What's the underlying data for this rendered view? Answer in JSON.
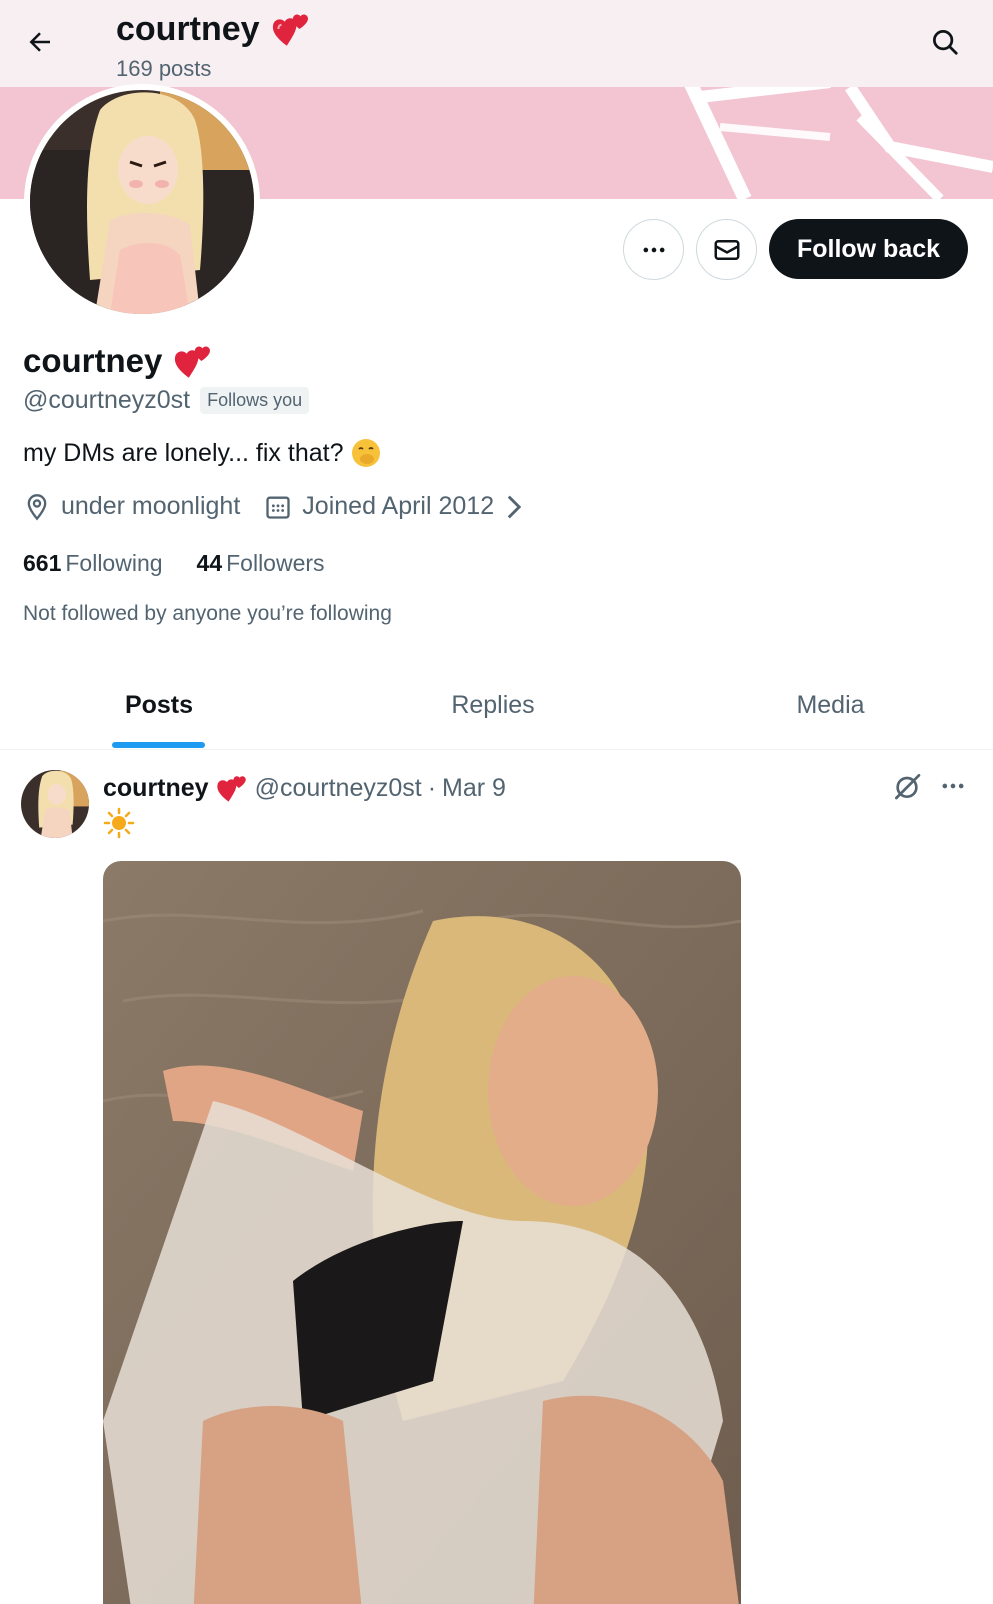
{
  "header": {
    "title": "courtney",
    "title_emoji": "heart-emoji",
    "posts_count": "169 posts",
    "back_icon": "arrow-left-icon",
    "search_icon": "search-icon"
  },
  "profile": {
    "name": "courtney",
    "handle": "@courtneyz0st",
    "follows_you": "Follows you",
    "bio": "my DMs are lonely... fix that?",
    "location": "under moonlight",
    "joined": "Joined April 2012",
    "following_count": "661",
    "following_label": "Following",
    "followers_count": "44",
    "followers_label": "Followers",
    "not_followed": "Not followed by anyone you’re following"
  },
  "actions": {
    "follow_back": "Follow back"
  },
  "tabs": [
    {
      "label": "Posts",
      "active": true
    },
    {
      "label": "Replies",
      "active": false
    },
    {
      "label": "Media",
      "active": false
    }
  ],
  "post": {
    "name": "courtney",
    "handle": "@courtneyz0st",
    "separator": "·",
    "date": "Mar 9",
    "text_emoji": "sun-emoji"
  },
  "colors": {
    "banner": "#f3c4d2",
    "accent": "#1d9bf0",
    "follow_button": "#0f1419",
    "secondary_text": "#536471"
  }
}
